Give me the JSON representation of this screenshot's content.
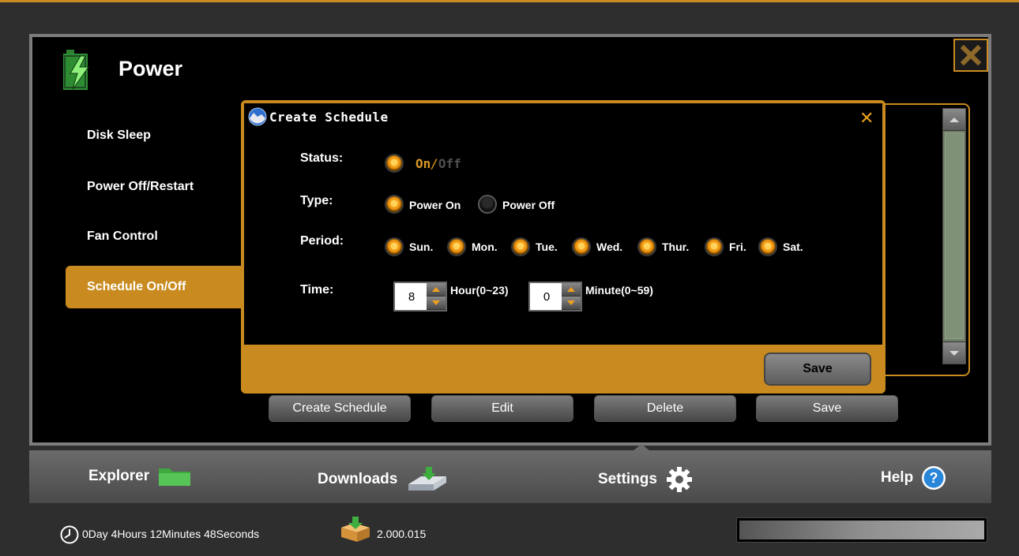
{
  "window": {
    "title": "Power"
  },
  "sidebar": {
    "items": [
      {
        "label": "Disk Sleep"
      },
      {
        "label": "Power Off/Restart"
      },
      {
        "label": "Fan Control"
      },
      {
        "label": "Schedule On/Off",
        "active": true
      }
    ]
  },
  "actions": {
    "create_schedule": "Create Schedule",
    "edit": "Edit",
    "delete": "Delete",
    "save": "Save"
  },
  "dialog": {
    "title": "Create Schedule",
    "status": {
      "label": "Status:",
      "on": "On",
      "separator": "/",
      "off": "Off",
      "selected": "On"
    },
    "type": {
      "label": "Type:",
      "options": [
        "Power On",
        "Power Off"
      ],
      "selected": "Power On"
    },
    "period": {
      "label": "Period:",
      "days": [
        "Sun.",
        "Mon.",
        "Tue.",
        "Wed.",
        "Thur.",
        "Fri.",
        "Sat."
      ]
    },
    "time": {
      "label": "Time:",
      "hour": {
        "value": "8",
        "unit": "Hour(0~23)"
      },
      "minute": {
        "value": "0",
        "unit": "Minute(0~59)"
      }
    },
    "save_label": "Save"
  },
  "nav": {
    "items": [
      {
        "label": "Explorer",
        "icon": "folder-icon"
      },
      {
        "label": "Downloads",
        "icon": "download-drive-icon"
      },
      {
        "label": "Settings",
        "icon": "gear-icon",
        "active": true
      },
      {
        "label": "Help",
        "icon": "help-icon"
      }
    ]
  },
  "status_bar": {
    "uptime": "0Day 4Hours 12Minutes 48Seconds",
    "version": "2.000.015"
  },
  "colors": {
    "accent": "#c98b1f",
    "panel": "#000000"
  }
}
